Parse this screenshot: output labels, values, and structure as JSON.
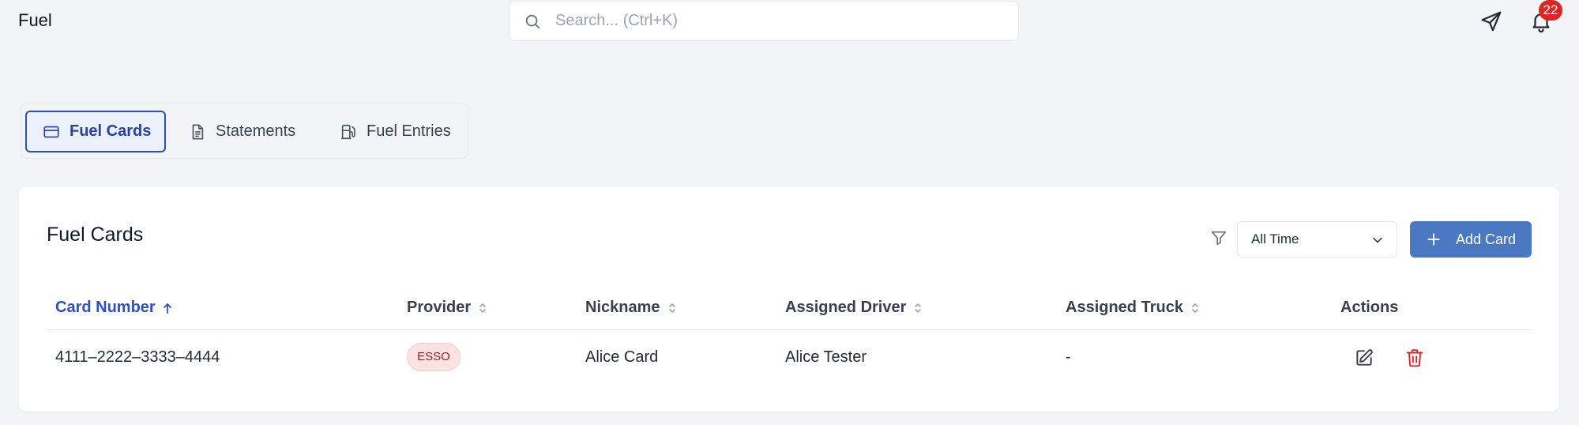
{
  "header": {
    "title": "Fuel",
    "search_placeholder": "Search... (Ctrl+K)",
    "notification_count": "22",
    "icons": [
      "search-icon",
      "send-icon",
      "bell-icon"
    ]
  },
  "tabs": [
    {
      "label": "Fuel Cards",
      "icon": "credit-card-icon",
      "active": true
    },
    {
      "label": "Statements",
      "icon": "document-icon",
      "active": false
    },
    {
      "label": "Fuel Entries",
      "icon": "fuel-pump-icon",
      "active": false
    }
  ],
  "card": {
    "title": "Fuel Cards",
    "filter": {
      "selected": "All Time"
    },
    "add_button_label": "Add Card"
  },
  "table": {
    "columns": [
      "Card Number",
      "Provider",
      "Nickname",
      "Assigned Driver",
      "Assigned Truck",
      "Actions"
    ],
    "sorted_column": "Card Number",
    "rows": [
      {
        "card_number": "4111–2222–3333–4444",
        "provider": "ESSO",
        "nickname": "Alice Card",
        "driver": "Alice Tester",
        "truck": "-"
      }
    ]
  },
  "colors": {
    "accent": "#2e4fad",
    "primary_button": "#4b78c2",
    "badge_red": "#dc2626",
    "delete_red": "#dc2626",
    "provider_badge_bg": "#fde2e2",
    "provider_badge_text": "#9b1c1c"
  }
}
